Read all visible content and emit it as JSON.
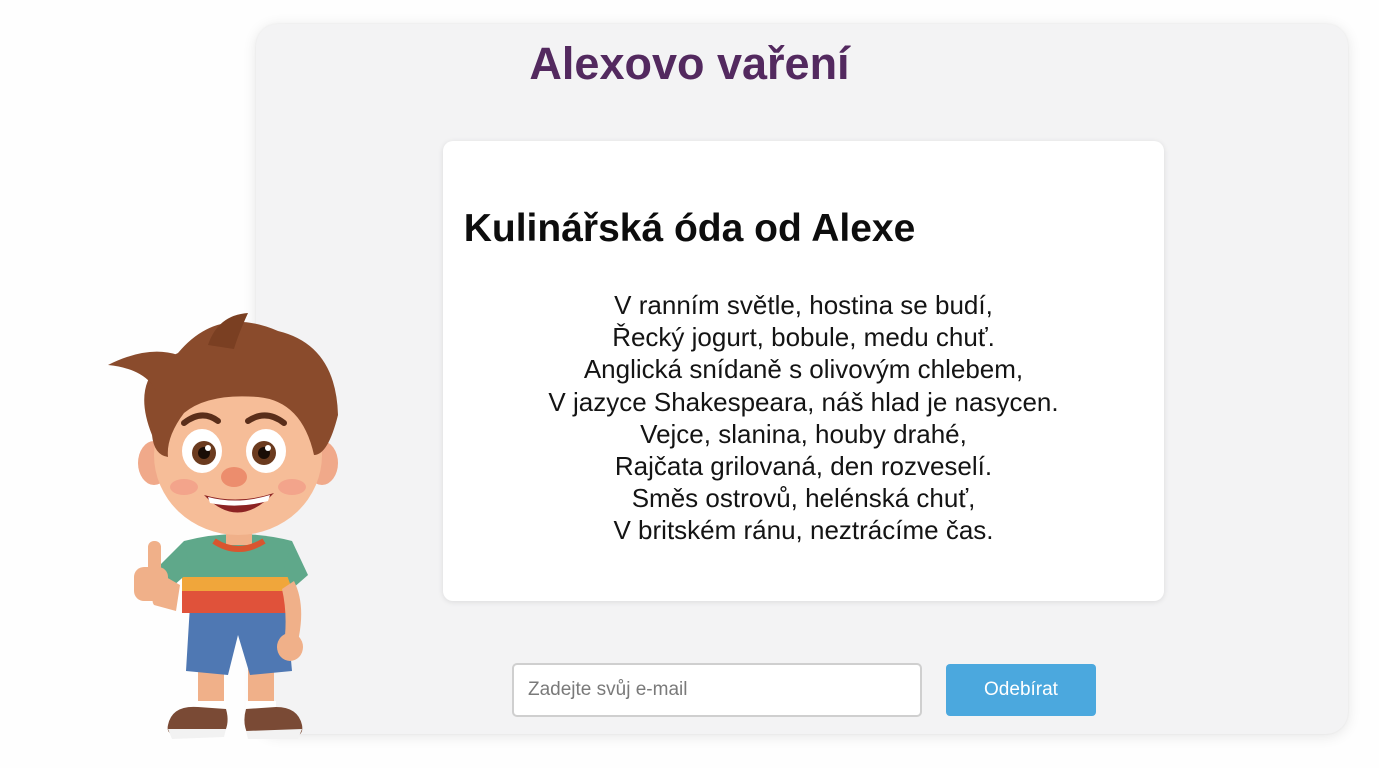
{
  "header": {
    "site_title": "Alexovo vaření"
  },
  "poem": {
    "title": "Kulinářská óda od Alexe",
    "lines": [
      "V ranním světle, hostina se budí,",
      "Řecký jogurt, bobule, medu chuť.",
      "Anglická snídaně s olivovým chlebem,",
      "V jazyce Shakespeara, náš hlad je nasycen.",
      "Vejce, slanina, houby drahé,",
      "Rajčata grilovaná, den rozveselí.",
      "Směs ostrovů, helénská chuť,",
      "V britském ránu, neztrácíme čas."
    ]
  },
  "subscribe": {
    "email_placeholder": "Zadejte svůj e-mail",
    "email_value": "",
    "button_label": "Odebírat"
  },
  "colors": {
    "title": "#53295f",
    "button": "#4ba8de",
    "panel": "#f3f3f4",
    "card": "#ffffff"
  },
  "mascot": {
    "icon": "cartoon-boy-thumbs-up"
  }
}
